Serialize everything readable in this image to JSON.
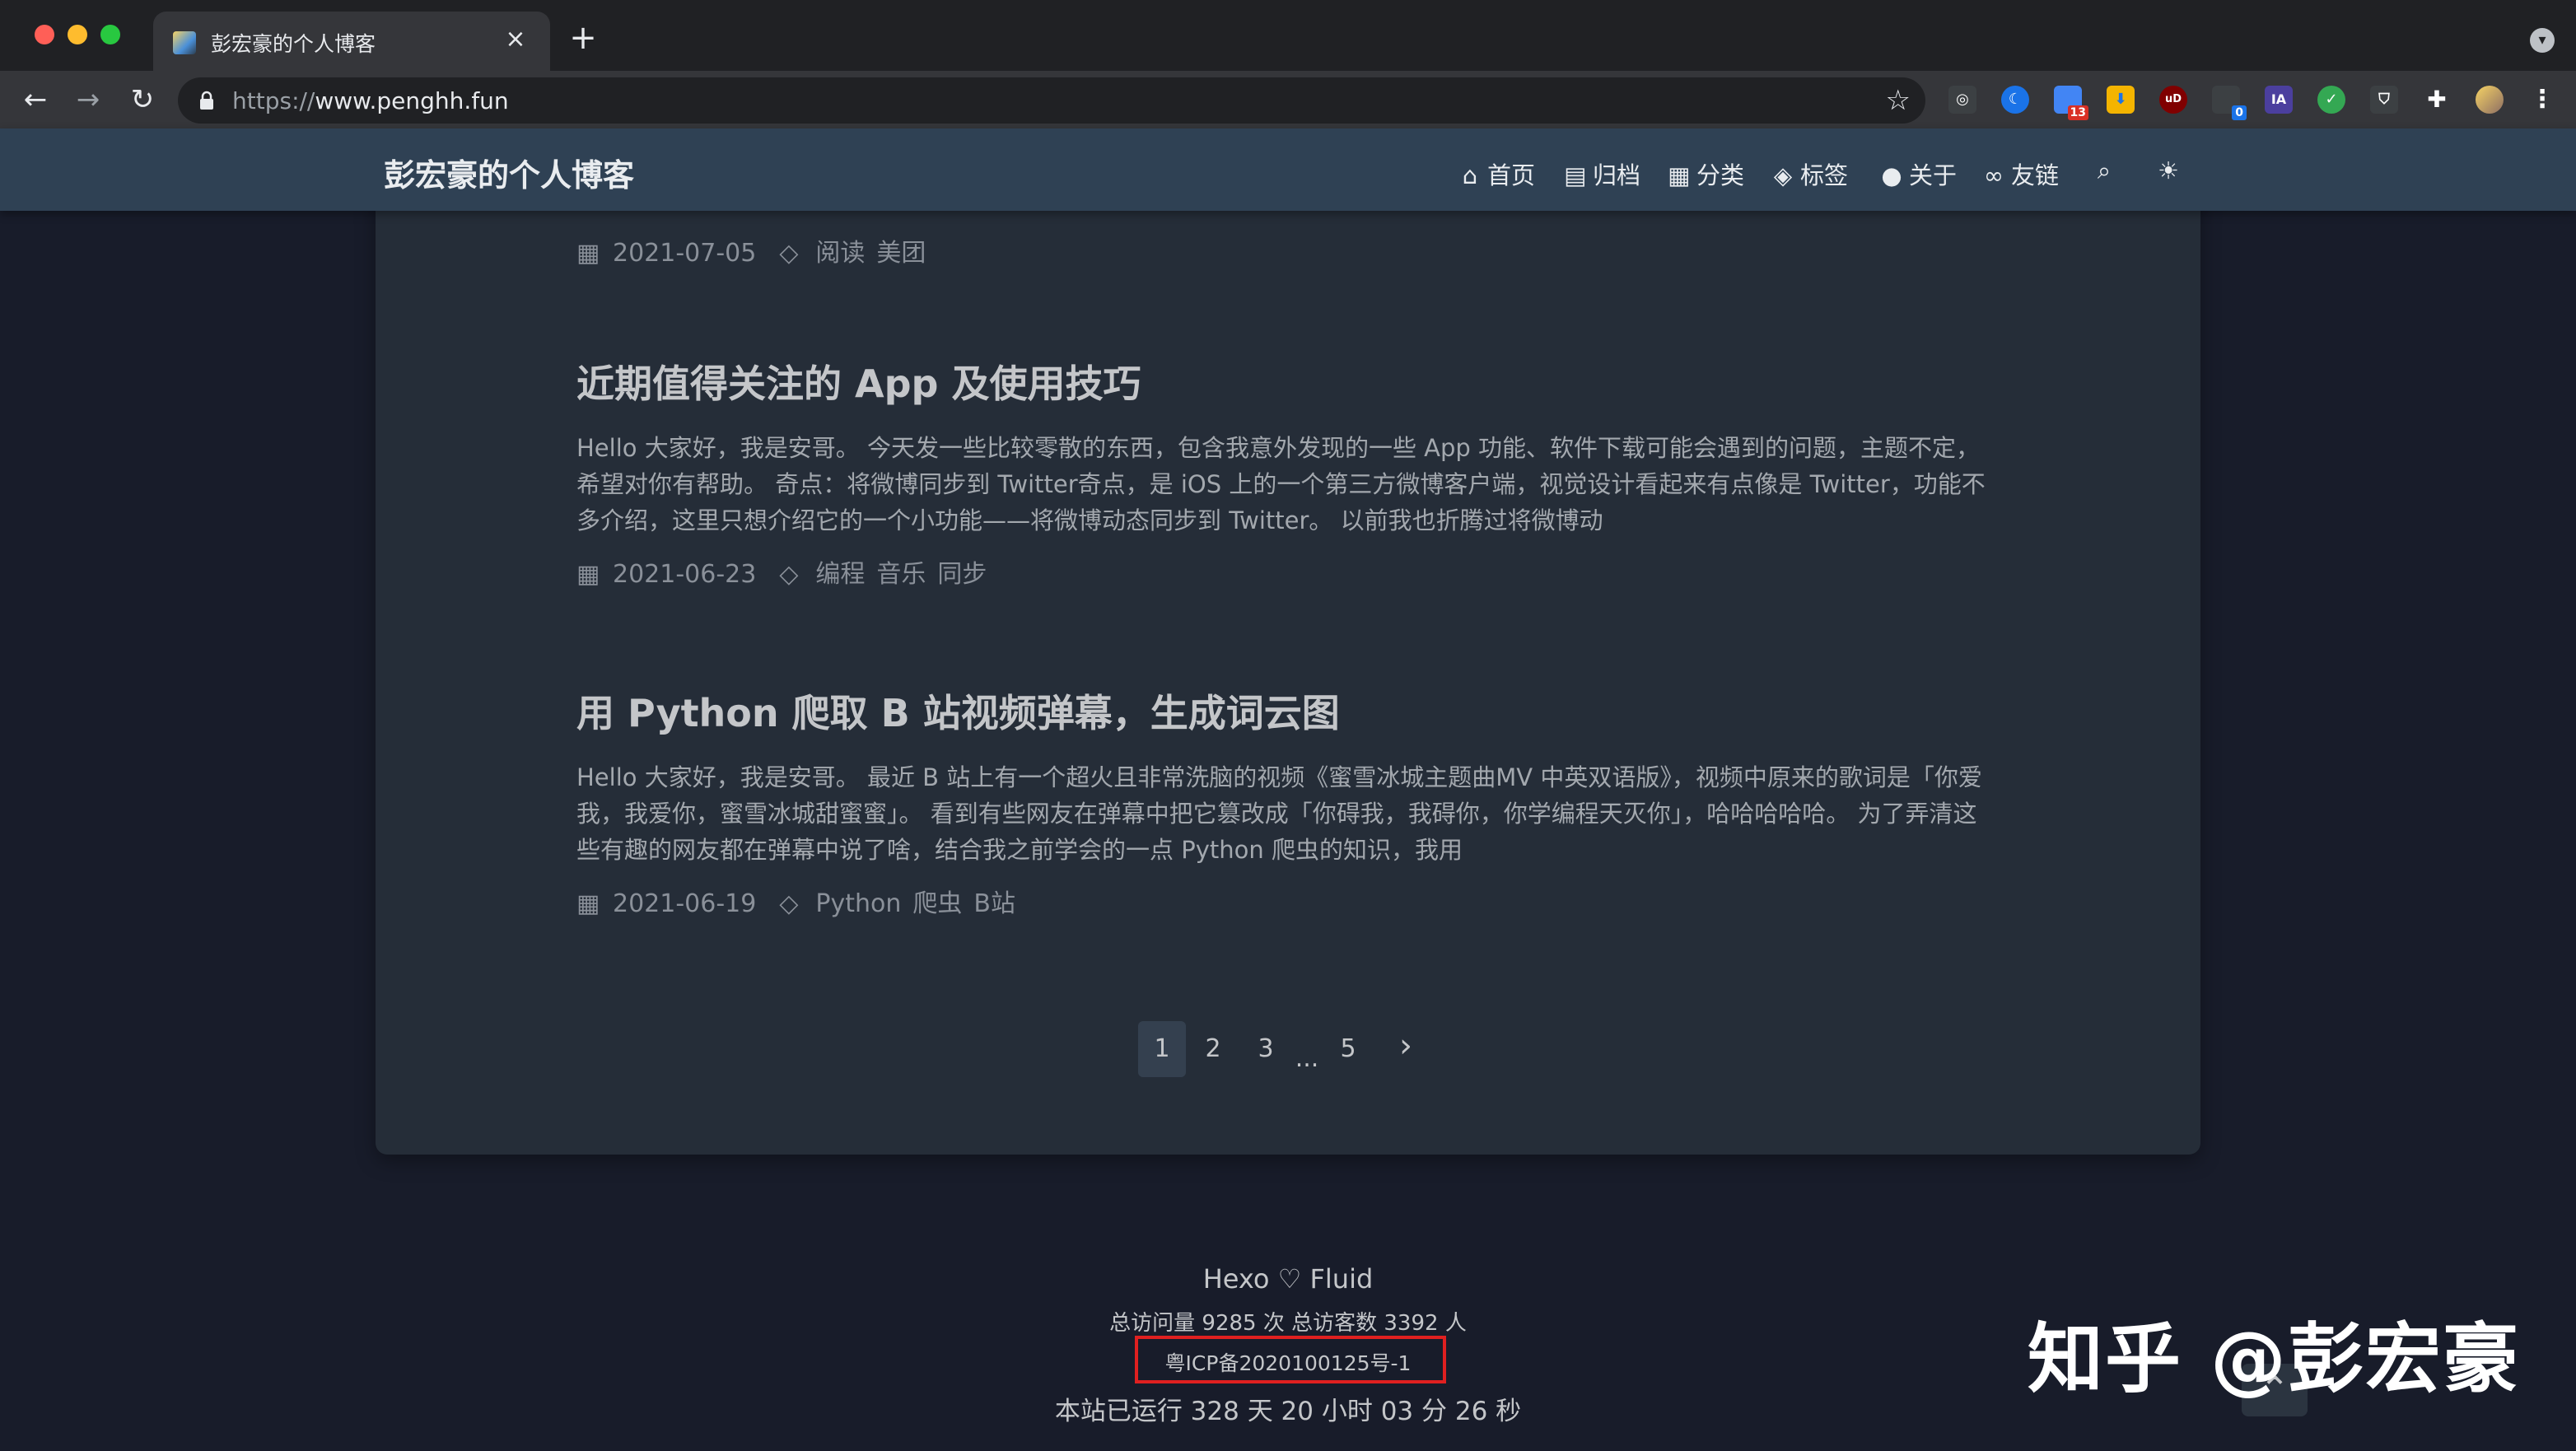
{
  "browser": {
    "tab_title": "彭宏豪的个人博客",
    "tab_close": "×",
    "new_tab": "+",
    "url_scheme": "https://",
    "url_host": "www.penghh.fun",
    "extension_badges": [
      "13",
      "0"
    ],
    "extension_labels": [
      "uD",
      "IA"
    ]
  },
  "site": {
    "brand": "彭宏豪的个人博客",
    "nav": [
      {
        "icon": "home-icon",
        "label": "首页"
      },
      {
        "icon": "archive-icon",
        "label": "归档"
      },
      {
        "icon": "category-icon",
        "label": "分类"
      },
      {
        "icon": "tags-icon",
        "label": "标签"
      },
      {
        "icon": "user-icon",
        "label": "关于"
      },
      {
        "icon": "link-icon",
        "label": "友链"
      }
    ]
  },
  "first_post_meta": {
    "date": "2021-07-05",
    "tags": [
      "阅读",
      "美团"
    ]
  },
  "posts": [
    {
      "title": "近期值得关注的 App 及使用技巧",
      "excerpt": "Hello 大家好，我是安哥。 今天发一些比较零散的东西，包含我意外发现的一些 App 功能、软件下载可能会遇到的问题，主题不定，希望对你有帮助。 奇点：将微博同步到 Twitter奇点，是 iOS 上的一个第三方微博客户端，视觉设计看起来有点像是 Twitter，功能不多介绍，这里只想介绍它的一个小功能——将微博动态同步到 Twitter。 以前我也折腾过将微博动",
      "date": "2021-06-23",
      "tags": [
        "编程",
        "音乐",
        "同步"
      ]
    },
    {
      "title": "用 Python 爬取 B 站视频弹幕，生成词云图",
      "excerpt": "Hello 大家好，我是安哥。 最近 B 站上有一个超火且非常洗脑的视频《蜜雪冰城主题曲MV 中英双语版》，视频中原来的歌词是「你爱我，我爱你，蜜雪冰城甜蜜蜜」。 看到有些网友在弹幕中把它篡改成「你碍我，我碍你，你学编程天灭你」，哈哈哈哈哈。 为了弄清这些有趣的网友都在弹幕中说了啥，结合我之前学会的一点 Python 爬虫的知识，我用",
      "date": "2021-06-19",
      "tags": [
        "Python",
        "爬虫",
        "B站"
      ]
    }
  ],
  "pagination": {
    "pages": [
      "1",
      "2",
      "3",
      "...",
      "5"
    ],
    "active": "1",
    "next": "›"
  },
  "footer": {
    "powered": "Hexo ♡ Fluid",
    "stats": "总访问量 9285 次  总访客数 3392 人",
    "icp": "粤ICP备2020100125号-1",
    "uptime": "本站已运行 328 天 20 小时 03 分 26 秒"
  },
  "watermark": "知乎 @彭宏豪",
  "colors": {
    "header": "#2f4154",
    "board": "#252d38",
    "background": "#181c2a",
    "icp_highlight": "#e02020"
  }
}
